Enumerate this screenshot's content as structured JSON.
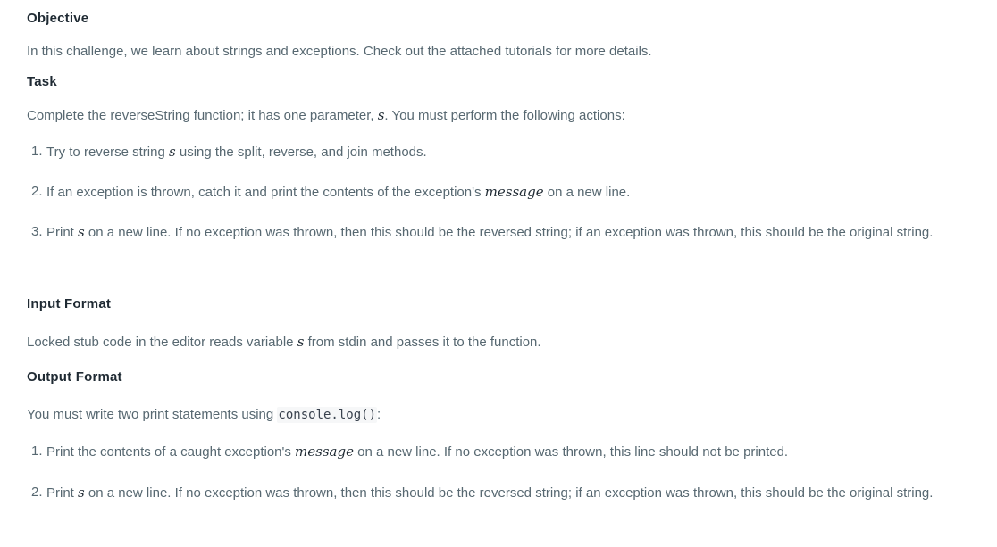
{
  "objective": {
    "heading": "Objective",
    "text": "In this challenge, we learn about strings and exceptions. Check out the attached tutorials for more details."
  },
  "task": {
    "heading": "Task",
    "intro_before": "Complete the reverseString function; it has one parameter, ",
    "intro_var": "s",
    "intro_after": ". You must perform the following actions:",
    "steps": [
      {
        "num": "1.",
        "before": "Try to reverse string ",
        "var": "s",
        "after": " using the split, reverse, and join methods."
      },
      {
        "num": "2.",
        "before": "If an exception is thrown, catch it and print the contents of the exception's ",
        "var": "message",
        "after": " on a new line."
      },
      {
        "num": "3.",
        "before": "Print ",
        "var": "s",
        "after": " on a new line. If no exception was thrown, then this should be the reversed string; if an exception was thrown, this should be the original string."
      }
    ]
  },
  "input_format": {
    "heading": "Input Format",
    "before": "Locked stub code in the editor reads variable ",
    "var": "s",
    "after": " from stdin and passes it to the function."
  },
  "output_format": {
    "heading": "Output Format",
    "intro_before": "You must write two print statements using ",
    "intro_code": "console.log()",
    "intro_after": ":",
    "steps": [
      {
        "num": "1.",
        "before": "Print the contents of a caught exception's ",
        "var": "message",
        "after": " on a new line. If no exception was thrown, this line should not be printed."
      },
      {
        "num": "2.",
        "before": "Print ",
        "var": "s",
        "after": " on a new line. If no exception was thrown, then this should be the reversed string; if an exception was thrown, this should be the original string."
      }
    ]
  }
}
